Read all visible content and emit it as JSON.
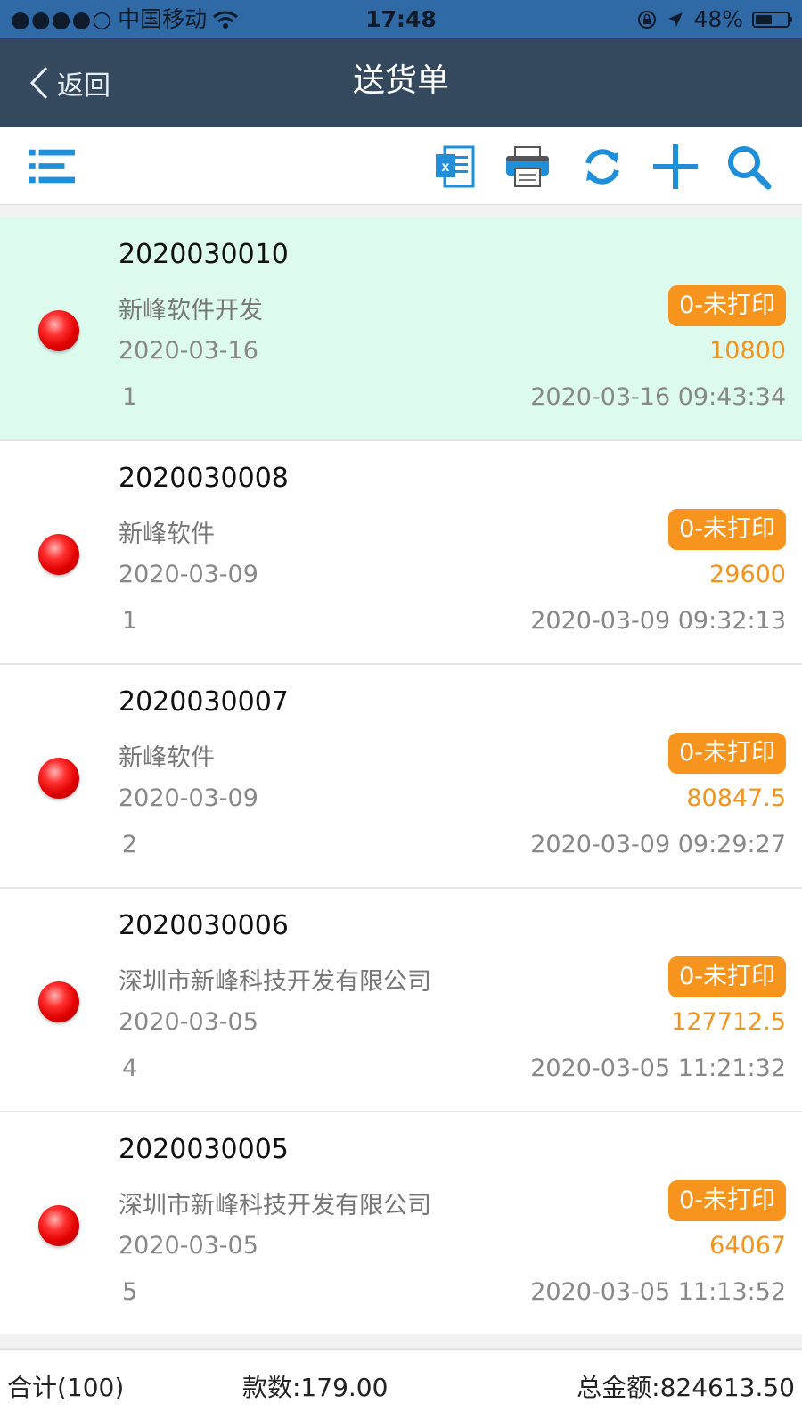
{
  "status_bar": {
    "signal": "●●●●○",
    "carrier": "中国移动",
    "time": "17:48",
    "battery": "48%",
    "battery_level": 0.48
  },
  "nav": {
    "back_label": "返回",
    "title": "送货单"
  },
  "toolbar": {
    "icons": [
      "list-menu-icon",
      "excel-export-icon",
      "printer-icon",
      "refresh-icon",
      "add-icon",
      "search-icon"
    ]
  },
  "rows": [
    {
      "doc_no": "2020030010",
      "customer": "新峰软件开发",
      "date": "2020-03-16",
      "count": "1",
      "status": "0-未打印",
      "amount": "10800",
      "timestamp": "2020-03-16 09:43:34",
      "selected": true
    },
    {
      "doc_no": "2020030008",
      "customer": "新峰软件",
      "date": "2020-03-09",
      "count": "1",
      "status": "0-未打印",
      "amount": "29600",
      "timestamp": "2020-03-09 09:32:13"
    },
    {
      "doc_no": "2020030007",
      "customer": "新峰软件",
      "date": "2020-03-09",
      "count": "2",
      "status": "0-未打印",
      "amount": "80847.5",
      "timestamp": "2020-03-09 09:29:27"
    },
    {
      "doc_no": "2020030006",
      "customer": "深圳市新峰科技开发有限公司",
      "date": "2020-03-05",
      "count": "4",
      "status": "0-未打印",
      "amount": "127712.5",
      "timestamp": "2020-03-05 11:21:32"
    },
    {
      "doc_no": "2020030005",
      "customer": "深圳市新峰科技开发有限公司",
      "date": "2020-03-05",
      "count": "5",
      "status": "0-未打印",
      "amount": "64067",
      "timestamp": "2020-03-05 11:13:52"
    }
  ],
  "footer": {
    "total": "合计(100)",
    "quantity": "款数:179.00",
    "amount": "总金额:824613.50"
  },
  "colors": {
    "nav_bg": "#34495e",
    "status_bg": "#2f6aa6",
    "accent_blue": "#1e8fd8",
    "badge_orange": "#f7941d",
    "selected_row": "#dcfbee"
  }
}
